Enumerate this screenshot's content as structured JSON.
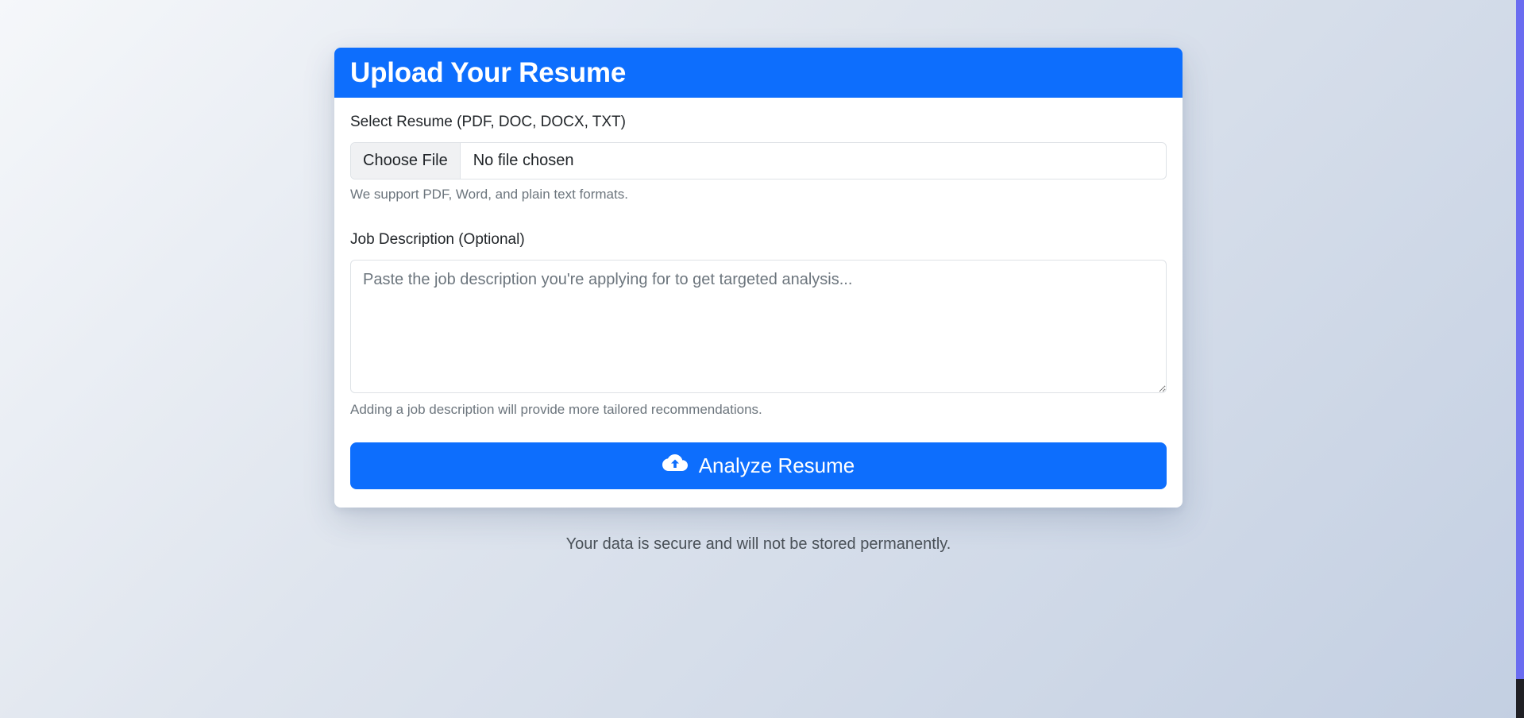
{
  "card": {
    "title": "Upload Your Resume",
    "resume_field": {
      "label": "Select Resume (PDF, DOC, DOCX, TXT)",
      "button_label": "Choose File",
      "status": "No file chosen",
      "help": "We support PDF, Word, and plain text formats."
    },
    "job_field": {
      "label": "Job Description (Optional)",
      "placeholder": "Paste the job description you're applying for to get targeted analysis...",
      "value": "",
      "help": "Adding a job description will provide more tailored recommendations."
    },
    "submit": {
      "icon": "cloud-upload-icon",
      "label": "Analyze Resume"
    }
  },
  "footer": {
    "note": "Your data is secure and will not be stored permanently."
  },
  "colors": {
    "primary": "#0d6efd",
    "scroll_thumb": "#6a6cf0"
  }
}
